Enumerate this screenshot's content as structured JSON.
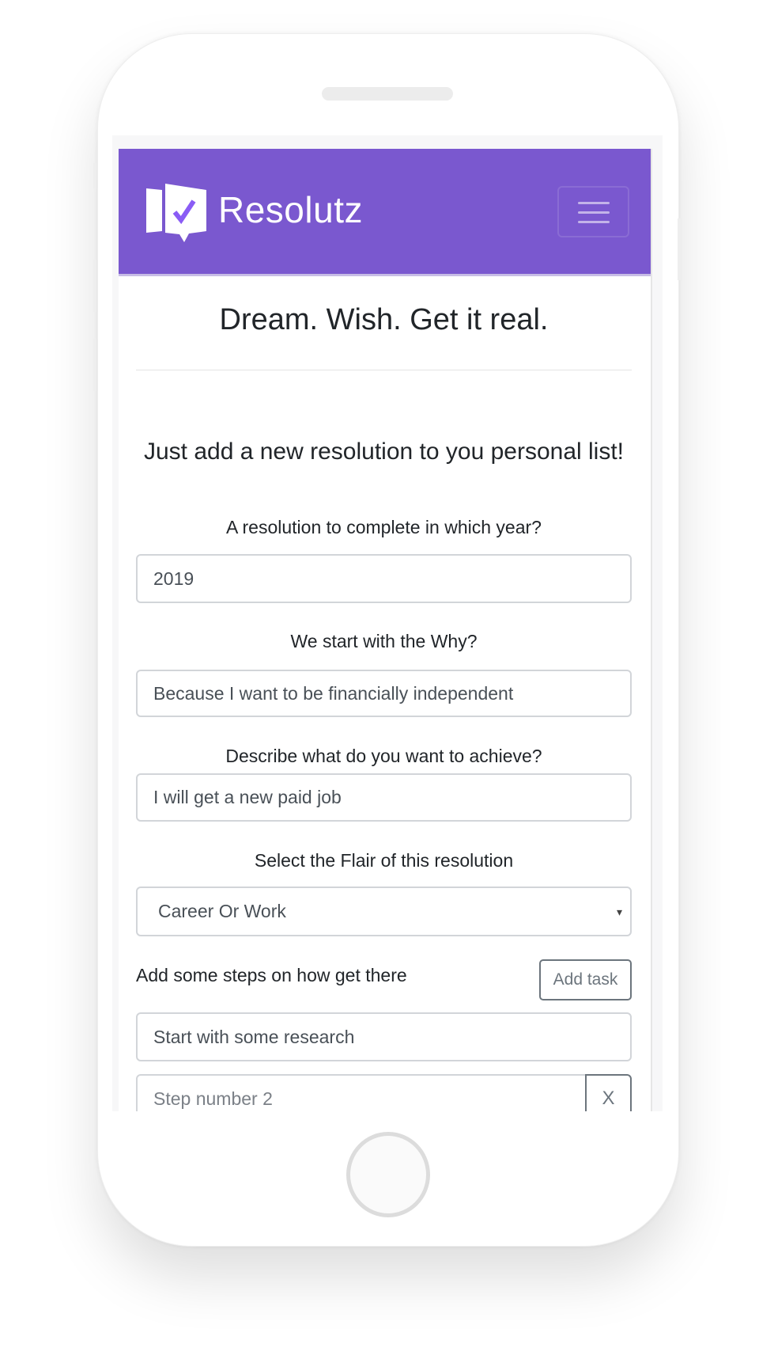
{
  "app": {
    "brand": "Resolutz",
    "accent_color": "#7a58cf"
  },
  "header": {
    "logo_icon": "flag-check-logo-icon",
    "menu_icon": "hamburger-icon"
  },
  "main": {
    "tagline": "Dream. Wish. Get it real.",
    "intro": "Just add a new resolution to you personal list!",
    "year": {
      "label": "A resolution to complete in which year?",
      "value": "2019"
    },
    "why": {
      "label": "We start with the Why?",
      "value": "Because I want to be financially independent"
    },
    "describe": {
      "label": "Describe what do you want to achieve?",
      "value": "I will get a new paid job"
    },
    "flair": {
      "label": "Select the Flair of this resolution",
      "selected": "Career Or Work",
      "caret": "▾"
    },
    "steps": {
      "label": "Add some steps on how get there",
      "add_task_label": "Add task",
      "items": [
        {
          "value": "Start with some research"
        },
        {
          "placeholder": "Step number 2",
          "remove_label": "X"
        }
      ]
    }
  }
}
